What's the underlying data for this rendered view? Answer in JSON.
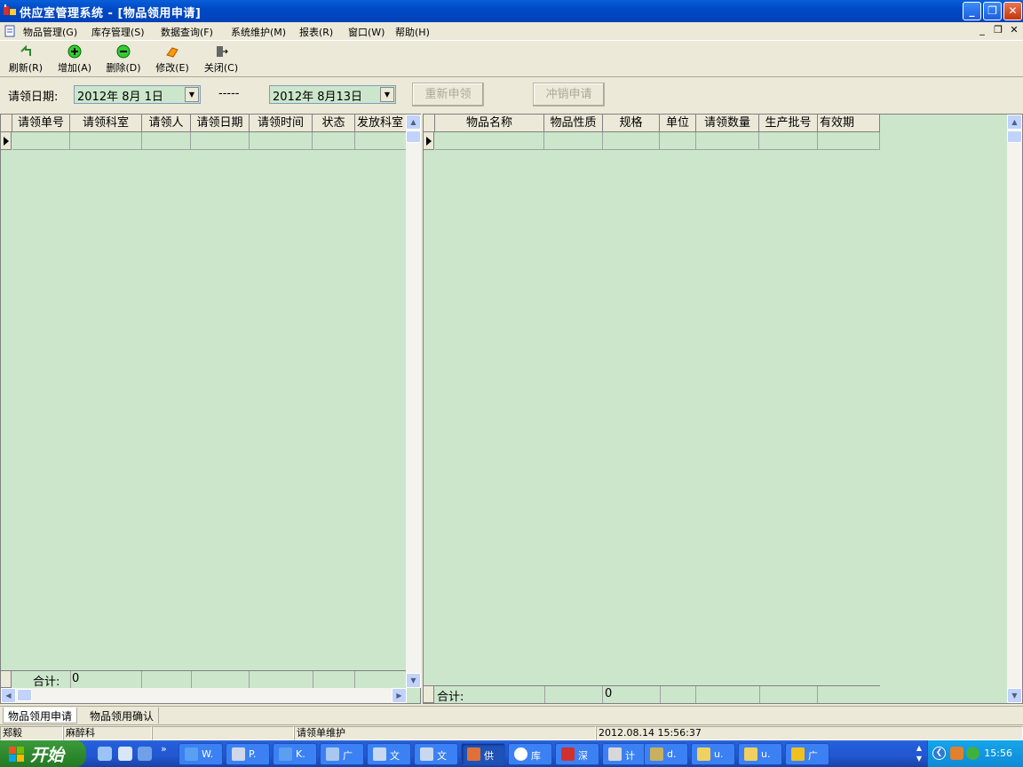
{
  "window": {
    "title": "供应室管理系统 - [物品领用申请]"
  },
  "menu": [
    {
      "label": "物品管理(G)"
    },
    {
      "label": "库存管理(S)"
    },
    {
      "label": "数据查询(F)"
    },
    {
      "label": "系统维护(M)"
    },
    {
      "label": "报表(R)"
    },
    {
      "label": "窗口(W)"
    },
    {
      "label": "帮助(H)"
    }
  ],
  "toolbar": {
    "refresh": "刷新(R)",
    "add": "增加(A)",
    "delete": "删除(D)",
    "edit": "修改(E)",
    "close": "关闭(C)"
  },
  "filter": {
    "label": "请领日期:",
    "from_date": "2012年  8月  1日",
    "separator": "-----",
    "to_date": "2012年  8月13日",
    "reapply_button": "重新申领",
    "cancel_button": "冲销申请"
  },
  "left_grid": {
    "columns": [
      "请领单号",
      "请领科室",
      "请领人",
      "请领日期",
      "请领时间",
      "状态",
      "发放科室"
    ],
    "total_label": "合计:",
    "total_value": "0"
  },
  "right_grid": {
    "columns": [
      "物品名称",
      "物品性质",
      "规格",
      "单位",
      "请领数量",
      "生产批号",
      "有效期"
    ],
    "total_label": "合计:",
    "total_value": "0"
  },
  "tabs": [
    "物品领用申请",
    "物品领用确认"
  ],
  "status": {
    "user": "郑毅",
    "dept": "麻醉科",
    "module": "请领单维护",
    "datetime": "2012.08.14  15:56:37"
  },
  "taskbar": {
    "start": "开始",
    "tasks": [
      "W.",
      "P.",
      "K.",
      "广",
      "文",
      "文",
      "供",
      "库",
      "深",
      "计",
      "d.",
      "u.",
      "u.",
      "广"
    ],
    "clock": "15:56"
  },
  "colors": {
    "grid_bg": "#cce6cc",
    "titlebar": "#0054e3",
    "taskbar": "#245edb"
  }
}
